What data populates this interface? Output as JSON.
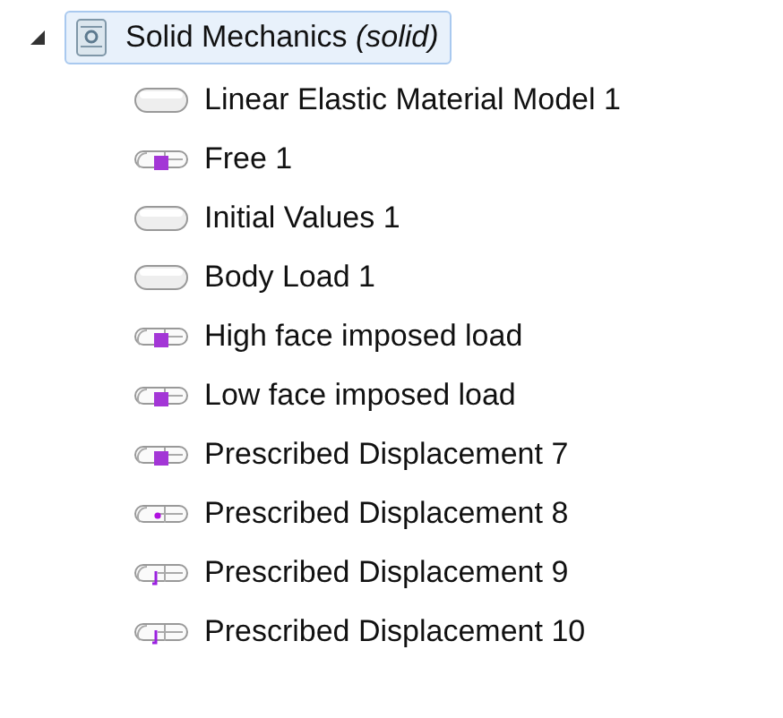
{
  "tree": {
    "label": "Solid Mechanics",
    "label_suffix": "(solid)",
    "expanded": true,
    "selected": true,
    "children": [
      {
        "label": "Linear Elastic Material Model 1",
        "kind": "domain"
      },
      {
        "label": "Free 1",
        "kind": "boundary"
      },
      {
        "label": "Initial Values 1",
        "kind": "domain"
      },
      {
        "label": "Body Load 1",
        "kind": "domain"
      },
      {
        "label": "High face imposed load",
        "kind": "boundary"
      },
      {
        "label": "Low face imposed load",
        "kind": "boundary"
      },
      {
        "label": "Prescribed Displacement 7",
        "kind": "boundary"
      },
      {
        "label": "Prescribed Displacement 8",
        "kind": "point"
      },
      {
        "label": "Prescribed Displacement 9",
        "kind": "edge"
      },
      {
        "label": "Prescribed Displacement 10",
        "kind": "edge"
      }
    ]
  }
}
